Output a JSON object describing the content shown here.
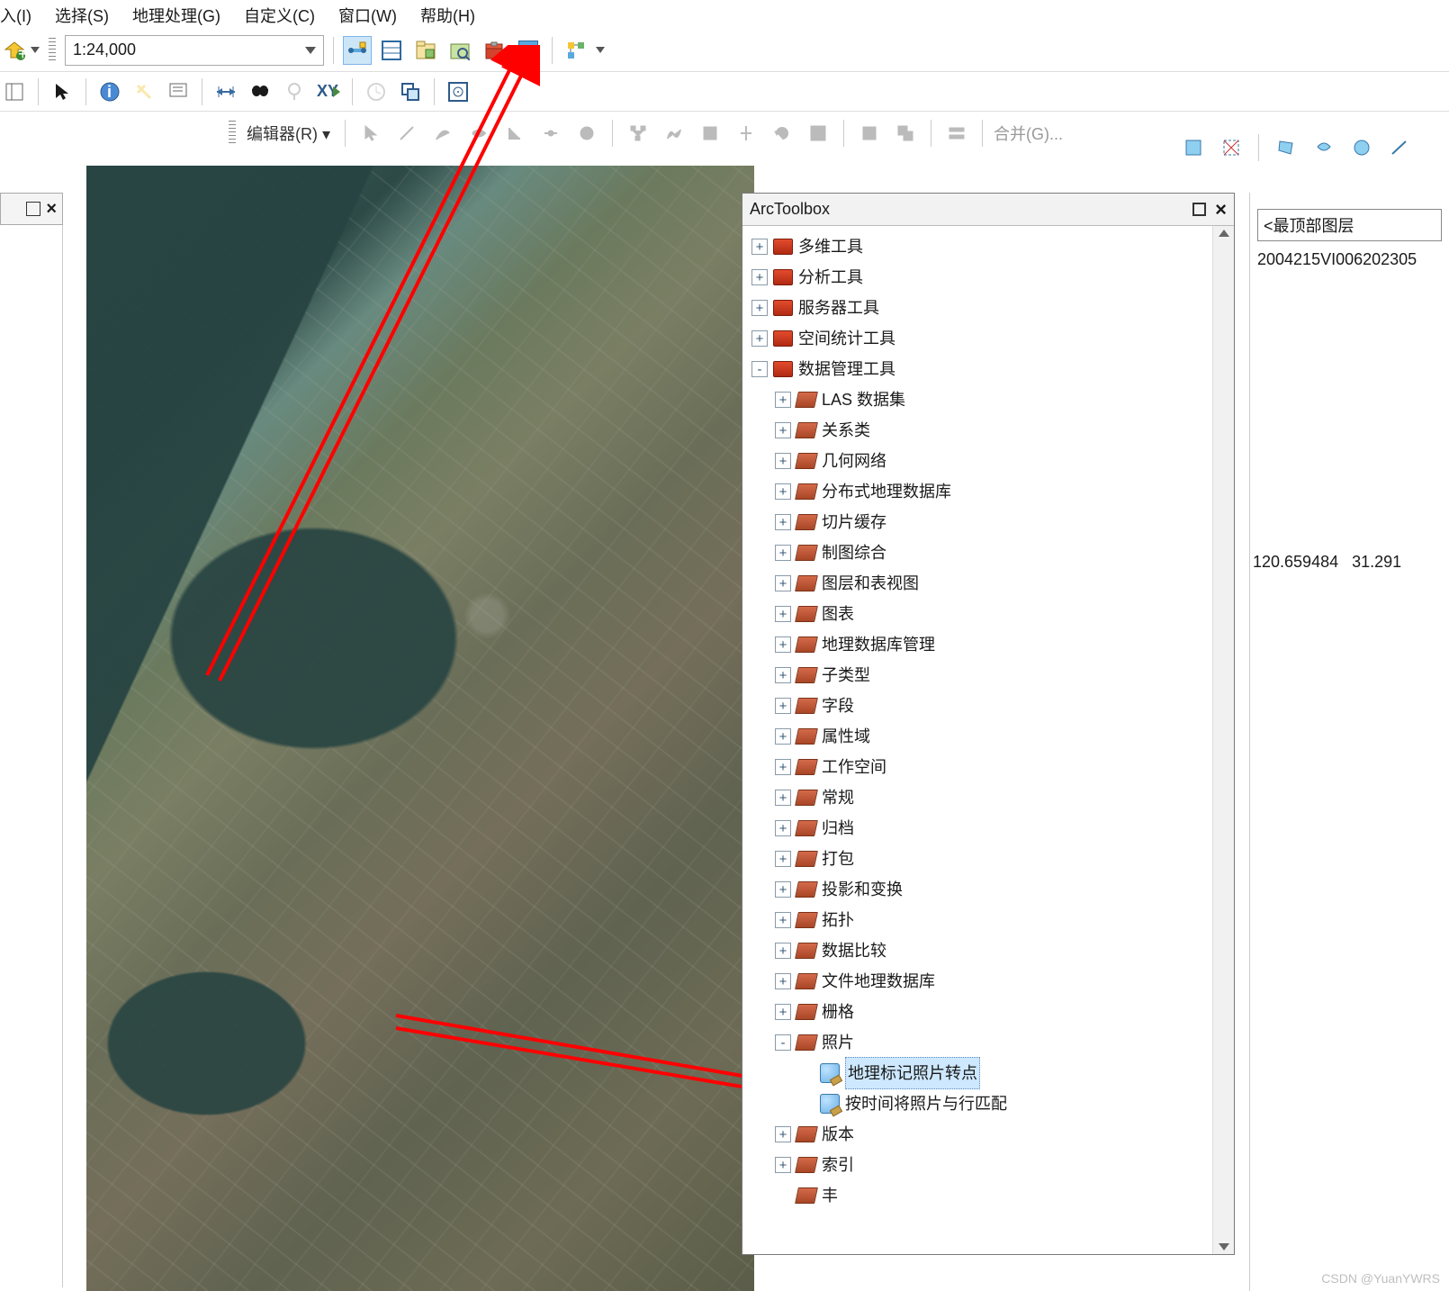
{
  "menu": {
    "insert": "入(I)",
    "select": "选择(S)",
    "geoproc": "地理处理(G)",
    "custom": "自定义(C)",
    "window": "窗口(W)",
    "help": "帮助(H)"
  },
  "scale": "1:24,000",
  "editor_label": "编辑器(R) ▾",
  "merge_label": "合并(G)...",
  "panel": {
    "title": "ArcToolbox",
    "root": [
      {
        "label": "多维工具"
      },
      {
        "label": "分析工具"
      },
      {
        "label": "服务器工具"
      },
      {
        "label": "空间统计工具"
      }
    ],
    "dm": {
      "label": "数据管理工具",
      "children": [
        "LAS 数据集",
        "关系类",
        "几何网络",
        "分布式地理数据库",
        "切片缓存",
        "制图综合",
        "图层和表视图",
        "图表",
        "地理数据库管理",
        "子类型",
        "字段",
        "属性域",
        "工作空间",
        "常规",
        "归档",
        "打包",
        "投影和变换",
        "拓扑",
        "数据比较",
        "文件地理数据库",
        "栅格"
      ]
    },
    "photo": {
      "label": "照片",
      "tools": [
        "地理标记照片转点",
        "按时间将照片与行匹配"
      ]
    },
    "tail": [
      "版本",
      "索引"
    ],
    "more": "丰"
  },
  "right": {
    "top": "<最顶部图层",
    "id": "2004215VI006202305"
  },
  "coord": {
    "x": "120.659484",
    "y": "31.291"
  },
  "watermark": "CSDN @YuanYWRS"
}
